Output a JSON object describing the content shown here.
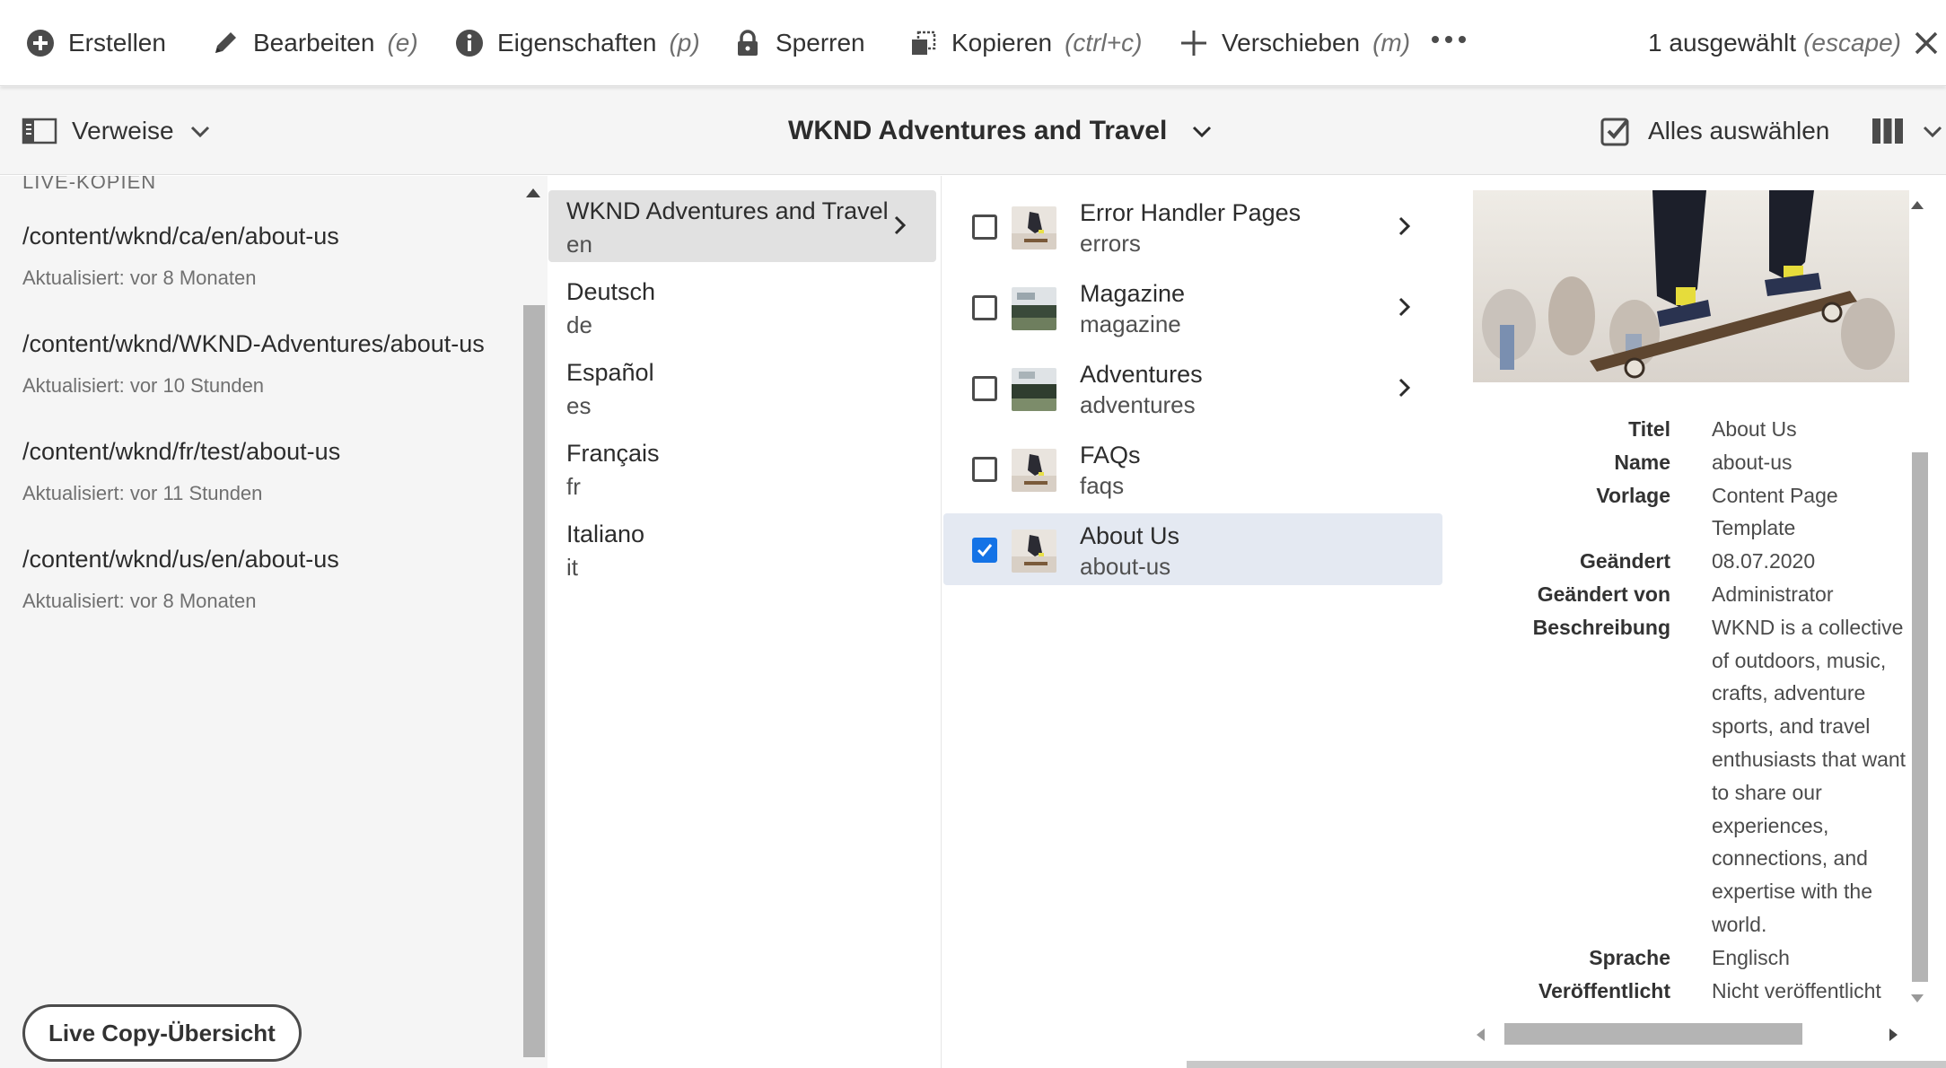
{
  "actionbar": {
    "create": "Erstellen",
    "edit": "Bearbeiten",
    "edit_key": "(e)",
    "properties": "Eigenschaften",
    "properties_key": "(p)",
    "lock": "Sperren",
    "copy": "Kopieren",
    "copy_key": "(ctrl+c)",
    "move": "Verschieben",
    "move_key": "(m)",
    "selected": "1 ausgewählt",
    "selected_key": "(escape)"
  },
  "subbar": {
    "rail_label": "Verweise",
    "title": "WKND Adventures and Travel",
    "select_all": "Alles auswählen"
  },
  "rail": {
    "heading": "LIVE-KOPIEN",
    "items": [
      {
        "path": "/content/wknd/ca/en/about-us",
        "meta": "Aktualisiert: vor 8 Monaten"
      },
      {
        "path": "/content/wknd/WKND-Adventures/about-us",
        "meta": "Aktualisiert: vor 10 Stunden"
      },
      {
        "path": "/content/wknd/fr/test/about-us",
        "meta": "Aktualisiert: vor 11 Stunden"
      },
      {
        "path": "/content/wknd/us/en/about-us",
        "meta": "Aktualisiert: vor 8 Monaten"
      }
    ],
    "button": "Live Copy-Übersicht"
  },
  "languages": [
    {
      "title": "WKND Adventures and Travel",
      "name": "en",
      "active": true
    },
    {
      "title": "Deutsch",
      "name": "de"
    },
    {
      "title": "Español",
      "name": "es"
    },
    {
      "title": "Français",
      "name": "fr"
    },
    {
      "title": "Italiano",
      "name": "it"
    }
  ],
  "pages": [
    {
      "title": "Error Handler Pages",
      "name": "errors",
      "checked": false
    },
    {
      "title": "Magazine",
      "name": "magazine",
      "checked": false
    },
    {
      "title": "Adventures",
      "name": "adventures",
      "checked": false
    },
    {
      "title": "FAQs",
      "name": "faqs",
      "checked": false
    },
    {
      "title": "About Us",
      "name": "about-us",
      "checked": true
    }
  ],
  "details": {
    "rows": [
      {
        "k": "Titel",
        "v": "About Us"
      },
      {
        "k": "Name",
        "v": "about-us"
      },
      {
        "k": "Vorlage",
        "v": "Content Page"
      },
      {
        "k": "",
        "v": "Template"
      },
      {
        "k": "Geändert",
        "v": "08.07.2020"
      },
      {
        "k": "Geändert von",
        "v": "Administrator"
      },
      {
        "k": "Beschreibung",
        "v": "WKND is a collective"
      },
      {
        "k": "",
        "v": "of outdoors, music,"
      },
      {
        "k": "",
        "v": "crafts, adventure"
      },
      {
        "k": "",
        "v": "sports, and travel"
      },
      {
        "k": "",
        "v": "enthusiasts that want"
      },
      {
        "k": "",
        "v": "to share our"
      },
      {
        "k": "",
        "v": "experiences,"
      },
      {
        "k": "",
        "v": "connections, and"
      },
      {
        "k": "",
        "v": "expertise with the"
      },
      {
        "k": "",
        "v": "world."
      },
      {
        "k": "Sprache",
        "v": "Englisch"
      },
      {
        "k": "Veröffentlicht",
        "v": "Nicht veröffentlicht"
      }
    ]
  },
  "colors": {
    "accent": "#1473e6",
    "selected_row": "#e4e9f2",
    "active_row": "#e1e1e1",
    "rail_bg": "#f5f5f5"
  }
}
